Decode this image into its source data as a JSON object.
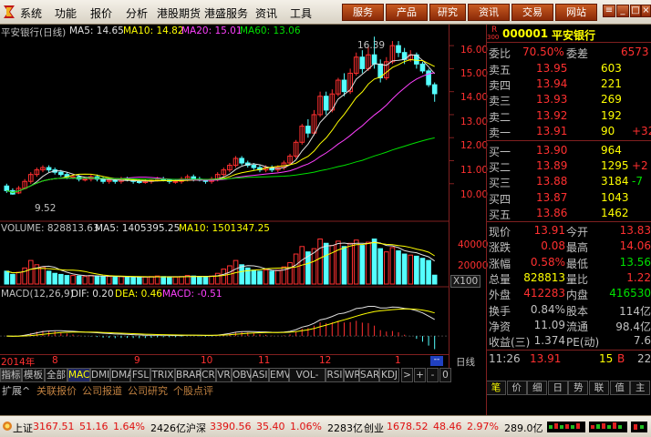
{
  "menubar": {
    "items": [
      "系统",
      "功能",
      "报价",
      "分析",
      "港股期货",
      "港盛服务",
      "资讯",
      "工具"
    ],
    "buttons": [
      "服务",
      "产品",
      "研究",
      "资讯",
      "交易",
      "网站"
    ]
  },
  "header": {
    "title": "平安银行(日线)",
    "ma5": "MA5: 14.65",
    "ma10": "MA10: 14.82",
    "ma20": "MA20: 15.01",
    "ma60": "MA60: 13.06"
  },
  "stock": {
    "code": "000001",
    "name": "平安银行",
    "prefix": "R",
    "sub": "300"
  },
  "volume_header": {
    "title": "VOLUME: 828813.63",
    "ma5": "MA5: 1405395.25",
    "ma10": "MA10: 1501347.25"
  },
  "macd_header": {
    "title": "MACD(12,26,9)",
    "dif": "DIF: 0.20",
    "dea": "DEA: 0.46",
    "macd": "MACD: -0.51"
  },
  "annotations": {
    "high": "16.39",
    "low": "9.52"
  },
  "price_axis": [
    "16.00",
    "15.00",
    "14.00",
    "13.00",
    "12.00",
    "11.00",
    "10.00"
  ],
  "volume_axis": [
    "40000",
    "20000",
    "X100"
  ],
  "date_axis": {
    "year": "2014年",
    "months": [
      "8",
      "9",
      "10",
      "11",
      "12",
      "1"
    ]
  },
  "period_label": "日线",
  "tabs": [
    "指标",
    "模板",
    "全部",
    "MACD",
    "DMI",
    "DMA",
    "FSL",
    "TRIX",
    "BRAR",
    "CR",
    "VR",
    "OBV",
    "ASI",
    "EMV",
    "VOL-TDX",
    "RSI",
    "WR",
    "SAR",
    "KDJ"
  ],
  "tab_arrows": [
    ">",
    "+",
    "-",
    "0"
  ],
  "links": [
    "扩展^",
    "关联报价",
    "公司报道",
    "公司研究",
    "个股点评"
  ],
  "quote": {
    "weibi": {
      "label": "委比",
      "value": "70.50%",
      "label2": "委差",
      "value2": "6573"
    },
    "asks": [
      {
        "label": "卖五",
        "price": "13.95",
        "vol": "603",
        "chg": ""
      },
      {
        "label": "卖四",
        "price": "13.94",
        "vol": "221",
        "chg": ""
      },
      {
        "label": "卖三",
        "price": "13.93",
        "vol": "269",
        "chg": ""
      },
      {
        "label": "卖二",
        "price": "13.92",
        "vol": "192",
        "chg": ""
      },
      {
        "label": "卖一",
        "price": "13.91",
        "vol": "90",
        "chg": "+32"
      }
    ],
    "bids": [
      {
        "label": "买一",
        "price": "13.90",
        "vol": "964",
        "chg": ""
      },
      {
        "label": "买二",
        "price": "13.89",
        "vol": "1295",
        "chg": "+2"
      },
      {
        "label": "买三",
        "price": "13.88",
        "vol": "3184",
        "chg": "-7"
      },
      {
        "label": "买四",
        "price": "13.87",
        "vol": "1043",
        "chg": ""
      },
      {
        "label": "买五",
        "price": "13.86",
        "vol": "1462",
        "chg": ""
      }
    ],
    "stats": [
      {
        "l1": "现价",
        "v1": "13.91",
        "l2": "今开",
        "v2": "13.83",
        "c1": "#ff3030",
        "c2": "#ff3030"
      },
      {
        "l1": "涨跌",
        "v1": "0.08",
        "l2": "最高",
        "v2": "14.06",
        "c1": "#ff3030",
        "c2": "#ff3030"
      },
      {
        "l1": "涨幅",
        "v1": "0.58%",
        "l2": "最低",
        "v2": "13.56",
        "c1": "#ff3030",
        "c2": "#00e000"
      },
      {
        "l1": "总量",
        "v1": "828813",
        "l2": "量比",
        "v2": "1.22",
        "c1": "#ffff00",
        "c2": "#ff3030"
      },
      {
        "l1": "外盘",
        "v1": "412283",
        "l2": "内盘",
        "v2": "416530",
        "c1": "#ff3030",
        "c2": "#00e000"
      },
      {
        "l1": "换手",
        "v1": "0.84%",
        "l2": "股本",
        "v2": "114亿",
        "c1": "#c0c0c0",
        "c2": "#c0c0c0"
      },
      {
        "l1": "净资",
        "v1": "11.09",
        "l2": "流通",
        "v2": "98.4亿",
        "c1": "#c0c0c0",
        "c2": "#c0c0c0"
      },
      {
        "l1": "收益(三)",
        "v1": "1.374",
        "l2": "PE(动)",
        "v2": "7.6",
        "c1": "#c0c0c0",
        "c2": "#c0c0c0"
      }
    ],
    "tick": {
      "time": "11:26",
      "price": "13.91",
      "vol": "15",
      "side": "B",
      "count": "228"
    },
    "bottom_tabs": [
      "笔",
      "价",
      "细",
      "日",
      "势",
      "联",
      "值",
      "主"
    ]
  },
  "status": [
    {
      "name": "上证",
      "price": "3167.51",
      "chg": "51.16",
      "pct": "1.64%",
      "amt": "2426亿"
    },
    {
      "name": "沪深",
      "price": "3390.56",
      "chg": "35.40",
      "pct": "1.06%",
      "amt": "2283亿"
    },
    {
      "name": "创业",
      "price": "1678.52",
      "chg": "48.46",
      "pct": "2.97%",
      "amt": "289.0亿"
    }
  ],
  "chart_data": {
    "type": "candlestick",
    "title": "平安银行(日线)",
    "price_range": [
      9.2,
      16.4
    ],
    "grid": false,
    "candles": [
      [
        9.9,
        9.7,
        10.0,
        9.6
      ],
      [
        9.7,
        9.55,
        9.8,
        9.52
      ],
      [
        9.6,
        9.8,
        9.9,
        9.55
      ],
      [
        9.8,
        10.1,
        10.2,
        9.75
      ],
      [
        10.1,
        10.4,
        10.5,
        10.0
      ],
      [
        10.4,
        10.6,
        10.7,
        10.3
      ],
      [
        10.6,
        10.7,
        10.8,
        10.5
      ],
      [
        10.7,
        10.6,
        10.8,
        10.5
      ],
      [
        10.6,
        10.5,
        10.7,
        10.4
      ],
      [
        10.5,
        10.4,
        10.6,
        10.3
      ],
      [
        10.4,
        10.3,
        10.5,
        10.2
      ],
      [
        10.3,
        10.3,
        10.4,
        10.2
      ],
      [
        10.3,
        10.2,
        10.4,
        10.1
      ],
      [
        10.2,
        10.2,
        10.3,
        10.1
      ],
      [
        10.2,
        10.3,
        10.4,
        10.1
      ],
      [
        10.3,
        10.2,
        10.4,
        10.1
      ],
      [
        10.2,
        10.1,
        10.3,
        10.0
      ],
      [
        10.1,
        10.15,
        10.2,
        10.0
      ],
      [
        10.15,
        10.1,
        10.2,
        10.0
      ],
      [
        10.1,
        10.2,
        10.3,
        10.0
      ],
      [
        10.2,
        10.15,
        10.3,
        10.1
      ],
      [
        10.15,
        10.1,
        10.2,
        10.0
      ],
      [
        10.1,
        10.05,
        10.2,
        10.0
      ],
      [
        10.05,
        10.1,
        10.2,
        10.0
      ],
      [
        10.1,
        10.15,
        10.2,
        10.0
      ],
      [
        10.15,
        10.2,
        10.3,
        10.1
      ],
      [
        10.2,
        10.15,
        10.3,
        10.1
      ],
      [
        10.15,
        10.1,
        10.2,
        10.0
      ],
      [
        10.1,
        10.1,
        10.2,
        10.0
      ],
      [
        10.1,
        10.2,
        10.3,
        10.0
      ],
      [
        10.2,
        10.3,
        10.4,
        10.1
      ],
      [
        10.3,
        10.2,
        10.4,
        10.1
      ],
      [
        10.2,
        10.15,
        10.3,
        10.1
      ],
      [
        10.15,
        10.1,
        10.2,
        10.0
      ],
      [
        10.1,
        10.2,
        10.3,
        10.0
      ],
      [
        10.2,
        10.4,
        10.5,
        10.1
      ],
      [
        10.4,
        10.6,
        10.7,
        10.3
      ],
      [
        10.6,
        10.8,
        10.9,
        10.5
      ],
      [
        10.8,
        11.1,
        11.2,
        10.7
      ],
      [
        11.1,
        10.9,
        11.2,
        10.8
      ],
      [
        10.9,
        10.8,
        11.0,
        10.7
      ],
      [
        10.8,
        10.7,
        10.9,
        10.6
      ],
      [
        10.7,
        10.6,
        10.8,
        10.5
      ],
      [
        10.6,
        10.7,
        10.8,
        10.5
      ],
      [
        10.7,
        10.6,
        10.8,
        10.5
      ],
      [
        10.6,
        10.7,
        10.8,
        10.5
      ],
      [
        10.7,
        10.9,
        11.0,
        10.6
      ],
      [
        10.9,
        11.2,
        11.3,
        10.8
      ],
      [
        11.2,
        11.8,
        11.9,
        11.1
      ],
      [
        11.8,
        12.5,
        12.6,
        11.7
      ],
      [
        12.5,
        12.2,
        12.8,
        12.0
      ],
      [
        12.2,
        13.0,
        13.2,
        12.1
      ],
      [
        13.0,
        13.8,
        14.0,
        12.9
      ],
      [
        13.8,
        13.2,
        14.0,
        13.0
      ],
      [
        13.2,
        13.9,
        14.1,
        13.1
      ],
      [
        13.9,
        14.5,
        14.6,
        13.8
      ],
      [
        14.5,
        14.0,
        14.8,
        13.8
      ],
      [
        14.0,
        14.8,
        15.0,
        13.9
      ],
      [
        14.8,
        15.5,
        15.7,
        14.7
      ],
      [
        15.5,
        15.0,
        15.8,
        14.8
      ],
      [
        15.0,
        15.6,
        16.0,
        14.9
      ],
      [
        15.6,
        15.2,
        16.39,
        15.0
      ],
      [
        15.2,
        14.6,
        15.4,
        14.4
      ],
      [
        14.6,
        15.3,
        15.5,
        14.5
      ],
      [
        15.3,
        16.0,
        16.2,
        15.2
      ],
      [
        16.0,
        15.7,
        16.2,
        15.5
      ],
      [
        15.7,
        15.4,
        15.9,
        15.2
      ],
      [
        15.4,
        15.6,
        15.8,
        15.3
      ],
      [
        15.6,
        15.2,
        15.7,
        15.0
      ],
      [
        15.2,
        14.9,
        15.3,
        14.8
      ],
      [
        14.9,
        14.3,
        15.0,
        14.2
      ],
      [
        14.3,
        13.91,
        14.4,
        13.56
      ]
    ],
    "volume": [
      12000,
      9000,
      11000,
      15000,
      22000,
      18000,
      16000,
      12000,
      10000,
      9000,
      8000,
      8000,
      7500,
      7000,
      8000,
      7500,
      7000,
      7000,
      6500,
      7000,
      7000,
      6500,
      6000,
      6500,
      7000,
      7500,
      7000,
      6500,
      6500,
      7000,
      8000,
      7500,
      7000,
      6500,
      7500,
      10000,
      14000,
      17000,
      22000,
      18000,
      15000,
      13000,
      12000,
      13000,
      12000,
      13000,
      16000,
      20000,
      28000,
      35000,
      30000,
      33000,
      42000,
      38000,
      36000,
      40000,
      35000,
      38000,
      41000,
      36000,
      39000,
      42000,
      33000,
      30000,
      34000,
      31000,
      28000,
      27000,
      26000,
      24000,
      22000,
      8300
    ],
    "vol_range": [
      0,
      45000
    ],
    "macd_range": [
      -0.6,
      1.4
    ]
  }
}
